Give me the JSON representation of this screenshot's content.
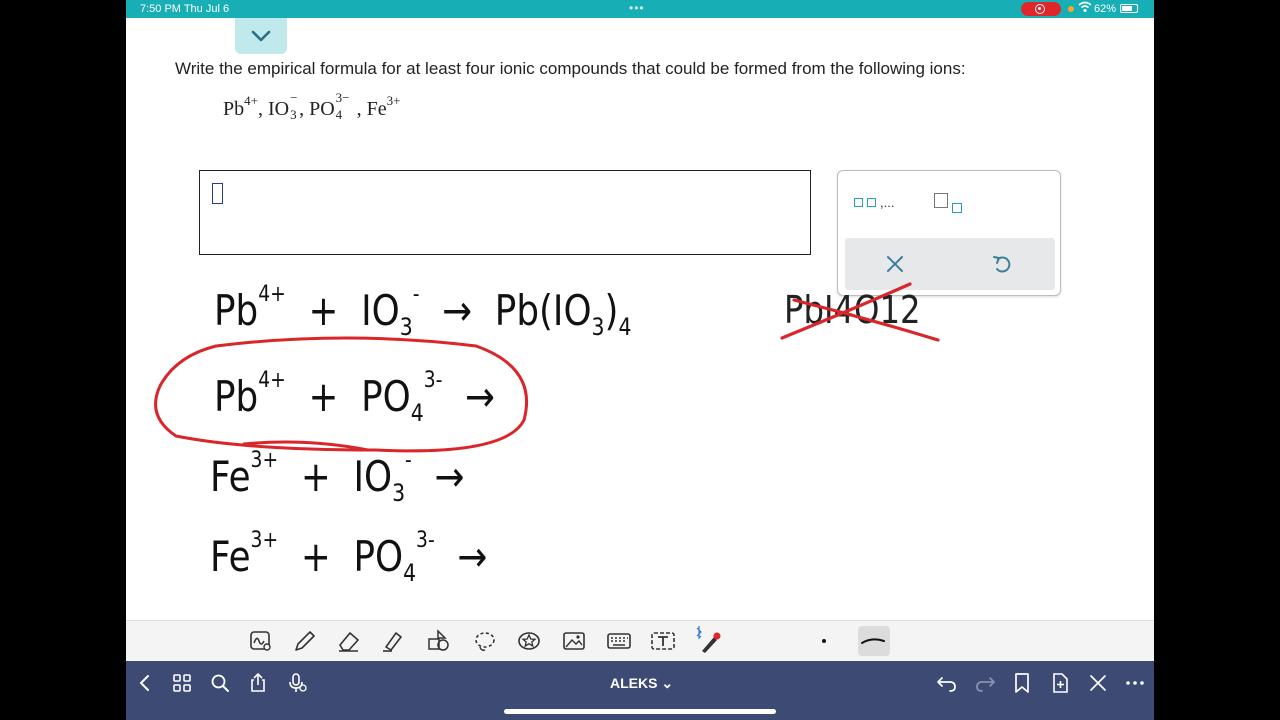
{
  "status_bar": {
    "time": "7:50 PM  Thu Jul 6",
    "dots": "•••",
    "battery": "62%"
  },
  "question": {
    "prompt": "Write the empirical formula for at least four ionic compounds that could be formed from the following ions:",
    "ions": [
      {
        "base": "Pb",
        "sup": "4+"
      },
      {
        "base": "IO",
        "sub": "3",
        "sup": "−"
      },
      {
        "base": "PO",
        "sub": "4",
        "sup": "3−"
      },
      {
        "base": "Fe",
        "sup": "3+"
      }
    ]
  },
  "palette": {
    "comma_list_label": ",...",
    "icons": [
      "comma-list-icon",
      "subscript-icon",
      "close-icon",
      "undo-icon"
    ]
  },
  "handwriting": {
    "line1": {
      "a": "Pb",
      "a_sup": "4+",
      "plus": "+",
      "b": "IO",
      "b_sub": "3",
      "b_sup": "-",
      "arrow": "→",
      "product": "Pb(IO",
      "product_sub": "3",
      "product_close": ")",
      "product_sub2": "4",
      "crossed": "PbI4O12"
    },
    "line2": {
      "a": "Pb",
      "a_sup": "4+",
      "plus": "+",
      "b": "PO",
      "b_sub": "4",
      "b_sup": "3-",
      "arrow": "→"
    },
    "line3": {
      "a": "Fe",
      "a_sup": "3+",
      "plus": "+",
      "b": "IO",
      "b_sub": "3",
      "b_sup": "-",
      "arrow": "→"
    },
    "line4": {
      "a": "Fe",
      "a_sup": "3+",
      "plus": "+",
      "b": "PO",
      "b_sub": "4",
      "b_sup": "3-",
      "arrow": "→"
    }
  },
  "colors": {
    "status_bar": "#18aeb5",
    "nav_bar": "#3d4b74",
    "annotation_red": "#d9262b",
    "accent": "#2a9fb0"
  },
  "nav_bar": {
    "title": "ALEKS ⌄"
  }
}
